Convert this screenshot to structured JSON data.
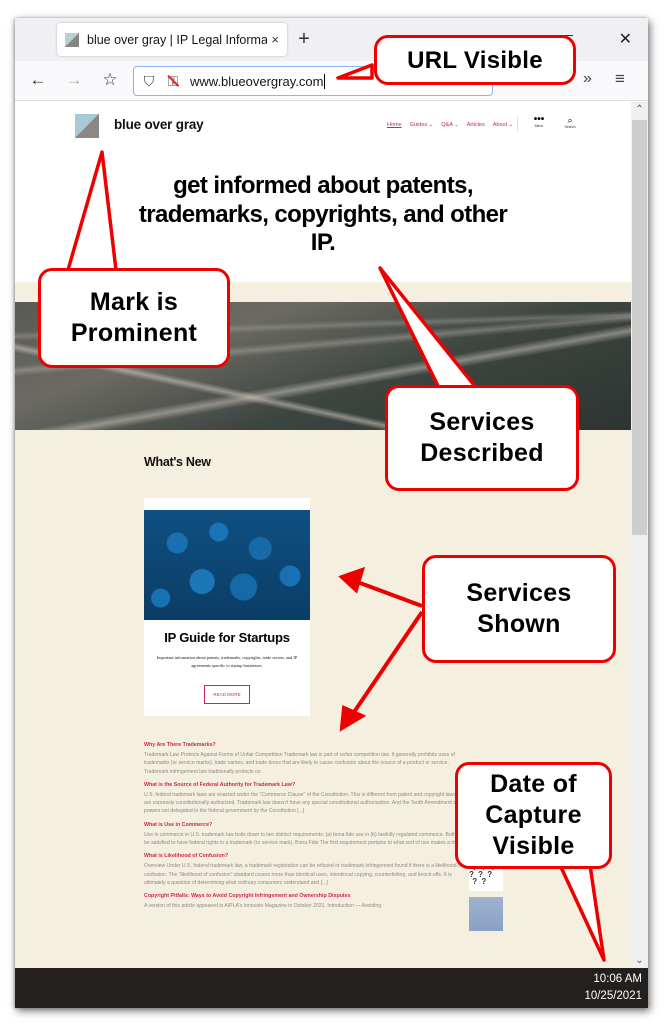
{
  "browser": {
    "tab_title": "blue over gray | IP Legal Informa",
    "tab_close_icon": "×",
    "new_tab_icon": "+",
    "window_close_icon": "✕",
    "window_minimize_icon": "—",
    "back_icon": "←",
    "forward_icon": "→",
    "bookmark_icon": "☆",
    "shield_icon": "⛉",
    "lock_icon": "🔒",
    "url": "www.blueovergray.com",
    "extensions_icon": "»",
    "menu_icon": "≡",
    "scroll_up_icon": "⌃",
    "scroll_down_icon": "⌄"
  },
  "site": {
    "name": "blue over gray",
    "nav": [
      {
        "label": "Home",
        "active": true
      },
      {
        "label": "Guides ⌄",
        "active": false
      },
      {
        "label": "Q&A ⌄",
        "active": false
      },
      {
        "label": "Articles",
        "active": false
      },
      {
        "label": "About ⌄",
        "active": false
      }
    ],
    "menu_dots": "•••",
    "menu_label": "Menu",
    "search_icon": "⌕",
    "search_label": "Search",
    "hero_title": "get informed about patents, trademarks, copyrights, and other IP.",
    "accent_color": "#cd2653"
  },
  "whats_new": {
    "heading": "What's New",
    "card": {
      "title": "IP Guide for Startups",
      "description": "Important information about patents, trademarks, copyrights, trade secrets, and IP agreements specific to startup businesses.",
      "button": "READ MORE"
    }
  },
  "articles": [
    {
      "title": "Why Are There Trademarks?",
      "body": "Trademark Law Protects Against Forms of Unfair Competition Trademark law is part of unfair competition law. It generally prohibits uses of trademarks (or service marks), trade names, and trade dress that are likely to cause confusion about the source of a product or service. Trademark infringement law traditionally protects co",
      "thumb": null
    },
    {
      "title": "What is the Source of Federal Authority for Trademark Law?",
      "body": "U.S. federal trademark laws are enacted under the \"Commerce Clause\" of the Constitution. This is different from patent and copyright laws, which are expressly constitutionally authorized. Trademark law doesn't have any special constitutional authorization. And the Tenth Amendment says that powers not delegated to the federal government by the Constitution [...]",
      "thumb": null
    },
    {
      "title": "What is Use in Commerce?",
      "body": "Use in commerce in U.S. trademark law boils down to two distinct requirements: (a) bona fide use in (b) lawfully regulated commerce. Both must be satisfied to have federal rights in a trademark (or service mark). Bona Fide The first requirement pertains to what sort of use makes a mark [...]",
      "thumb": null
    },
    {
      "title": "What is Likelihood of Confusion?",
      "body": "Overview Under U.S. federal trademark law, a trademark registration can be refused or trademark infringement found if there is a likelihood of confusion. The \"likelihood of confusion\" standard covers more than identical uses, intentional copying, counterfeiting, and knock-offs. It is ultimately a question of determining what ordinary consumers understand and [...]",
      "thumb": "question-marks"
    },
    {
      "title": "Copyright Pitfalls: Ways to Avoid Copyright Infringement and Ownership Disputes",
      "body": "A version of this article appeared in AIPLA's Innovate Magazine in October 2021. Introduction — Avoiding",
      "thumb": "sky"
    }
  ],
  "taskbar": {
    "time": "10:06 AM",
    "date": "10/25/2021"
  },
  "annotations": [
    {
      "id": "url",
      "text": "URL Visible"
    },
    {
      "id": "mark",
      "text": "Mark is Prominent"
    },
    {
      "id": "services-described",
      "text": "Services Described"
    },
    {
      "id": "services-shown",
      "text": "Services Shown"
    },
    {
      "id": "date",
      "text": "Date of Capture Visible"
    }
  ],
  "annotation_color": "#ee0000"
}
